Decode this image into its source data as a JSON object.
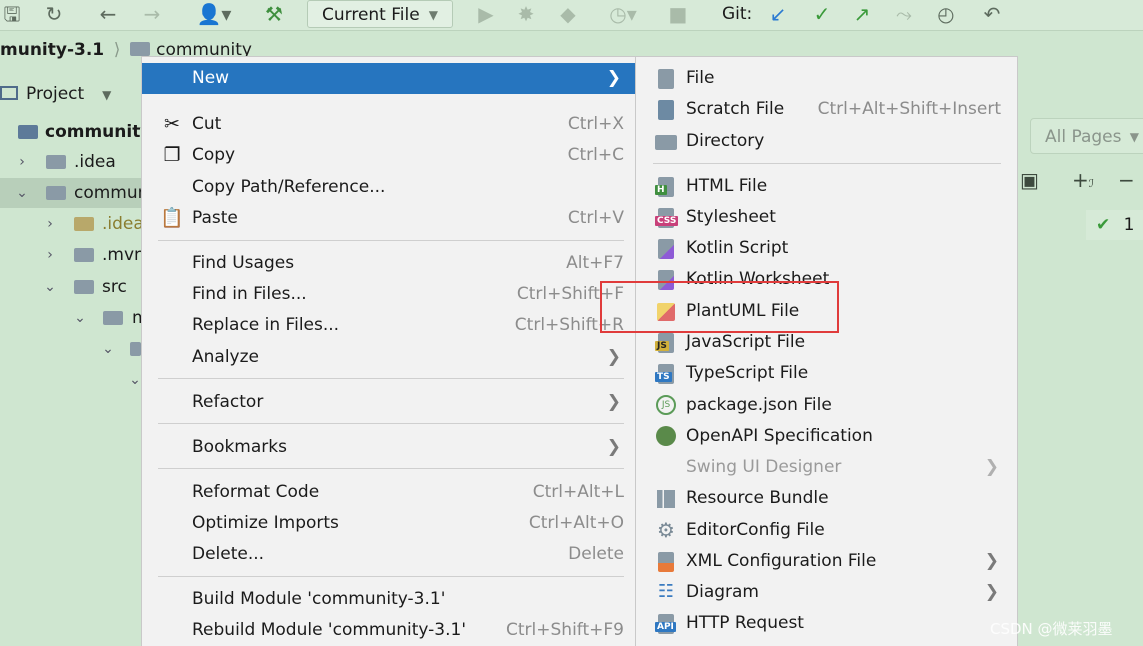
{
  "toolbar": {
    "current_file": "Current File",
    "git_label": "Git:",
    "icons": [
      "save-icon",
      "sync-icon",
      "back-arrow-icon",
      "forward-arrow-icon",
      "user-icon",
      "build-hammer-icon",
      "run-icon",
      "debug-icon",
      "coverage-icon",
      "profile-icon",
      "more-run-icon",
      "stop-icon",
      "git-update-icon",
      "git-commit-icon",
      "git-push-icon",
      "git-merge-icon",
      "history-icon",
      "rollback-icon"
    ]
  },
  "breadcrumb": {
    "project": "munity-3.1",
    "folder": "community"
  },
  "project_panel": {
    "title": "Project",
    "tree": [
      {
        "label": "community",
        "bold": true
      },
      {
        "label": ".idea"
      },
      {
        "label": "commun"
      },
      {
        "label": ".idea"
      },
      {
        "label": ".mvn"
      },
      {
        "label": "src"
      },
      {
        "label": "m"
      },
      {
        "label": ""
      },
      {
        "label": ""
      }
    ]
  },
  "right_panel": {
    "all_pages": "All Pages",
    "check_count": "1"
  },
  "watermark": "CSDN @微莱羽墨",
  "context_menu": {
    "items": [
      {
        "label": "New",
        "shortcut": "",
        "submenu": true
      },
      {
        "label": "Cut",
        "shortcut": "Ctrl+X",
        "icon": "scissors-icon"
      },
      {
        "label": "Copy",
        "shortcut": "Ctrl+C",
        "icon": "copy-icon"
      },
      {
        "label": "Copy Path/Reference...",
        "shortcut": ""
      },
      {
        "label": "Paste",
        "shortcut": "Ctrl+V",
        "icon": "paste-icon"
      },
      {
        "label": "Find Usages",
        "shortcut": "Alt+F7"
      },
      {
        "label": "Find in Files...",
        "shortcut": "Ctrl+Shift+F"
      },
      {
        "label": "Replace in Files...",
        "shortcut": "Ctrl+Shift+R"
      },
      {
        "label": "Analyze",
        "shortcut": "",
        "submenu": true
      },
      {
        "label": "Refactor",
        "shortcut": "",
        "submenu": true
      },
      {
        "label": "Bookmarks",
        "shortcut": "",
        "submenu": true
      },
      {
        "label": "Reformat Code",
        "shortcut": "Ctrl+Alt+L"
      },
      {
        "label": "Optimize Imports",
        "shortcut": "Ctrl+Alt+O"
      },
      {
        "label": "Delete...",
        "shortcut": "Delete"
      },
      {
        "label": "Build Module 'community-3.1'",
        "shortcut": ""
      },
      {
        "label": "Rebuild Module 'community-3.1'",
        "shortcut": "Ctrl+Shift+F9"
      }
    ]
  },
  "new_submenu": {
    "items": [
      {
        "label": "File",
        "shortcut": ""
      },
      {
        "label": "Scratch File",
        "shortcut": "Ctrl+Alt+Shift+Insert"
      },
      {
        "label": "Directory",
        "shortcut": ""
      },
      {
        "label": "HTML File",
        "badge": "H"
      },
      {
        "label": "Stylesheet",
        "badge": "CSS"
      },
      {
        "label": "Kotlin Script"
      },
      {
        "label": "Kotlin Worksheet"
      },
      {
        "label": "PlantUML File"
      },
      {
        "label": "JavaScript File",
        "badge": "JS"
      },
      {
        "label": "TypeScript File",
        "badge": "TS"
      },
      {
        "label": "package.json File"
      },
      {
        "label": "OpenAPI Specification"
      },
      {
        "label": "Swing UI Designer",
        "disabled": true,
        "submenu": true
      },
      {
        "label": "Resource Bundle"
      },
      {
        "label": "EditorConfig File"
      },
      {
        "label": "XML Configuration File",
        "submenu": true
      },
      {
        "label": "Diagram",
        "submenu": true
      },
      {
        "label": "HTTP Request",
        "badge": "API"
      }
    ]
  },
  "colors": {
    "background": "#cfe6d0",
    "menu_bg": "#f2f2f2",
    "menu_selected": "#2675bf",
    "highlight_box": "#e03b3b"
  }
}
